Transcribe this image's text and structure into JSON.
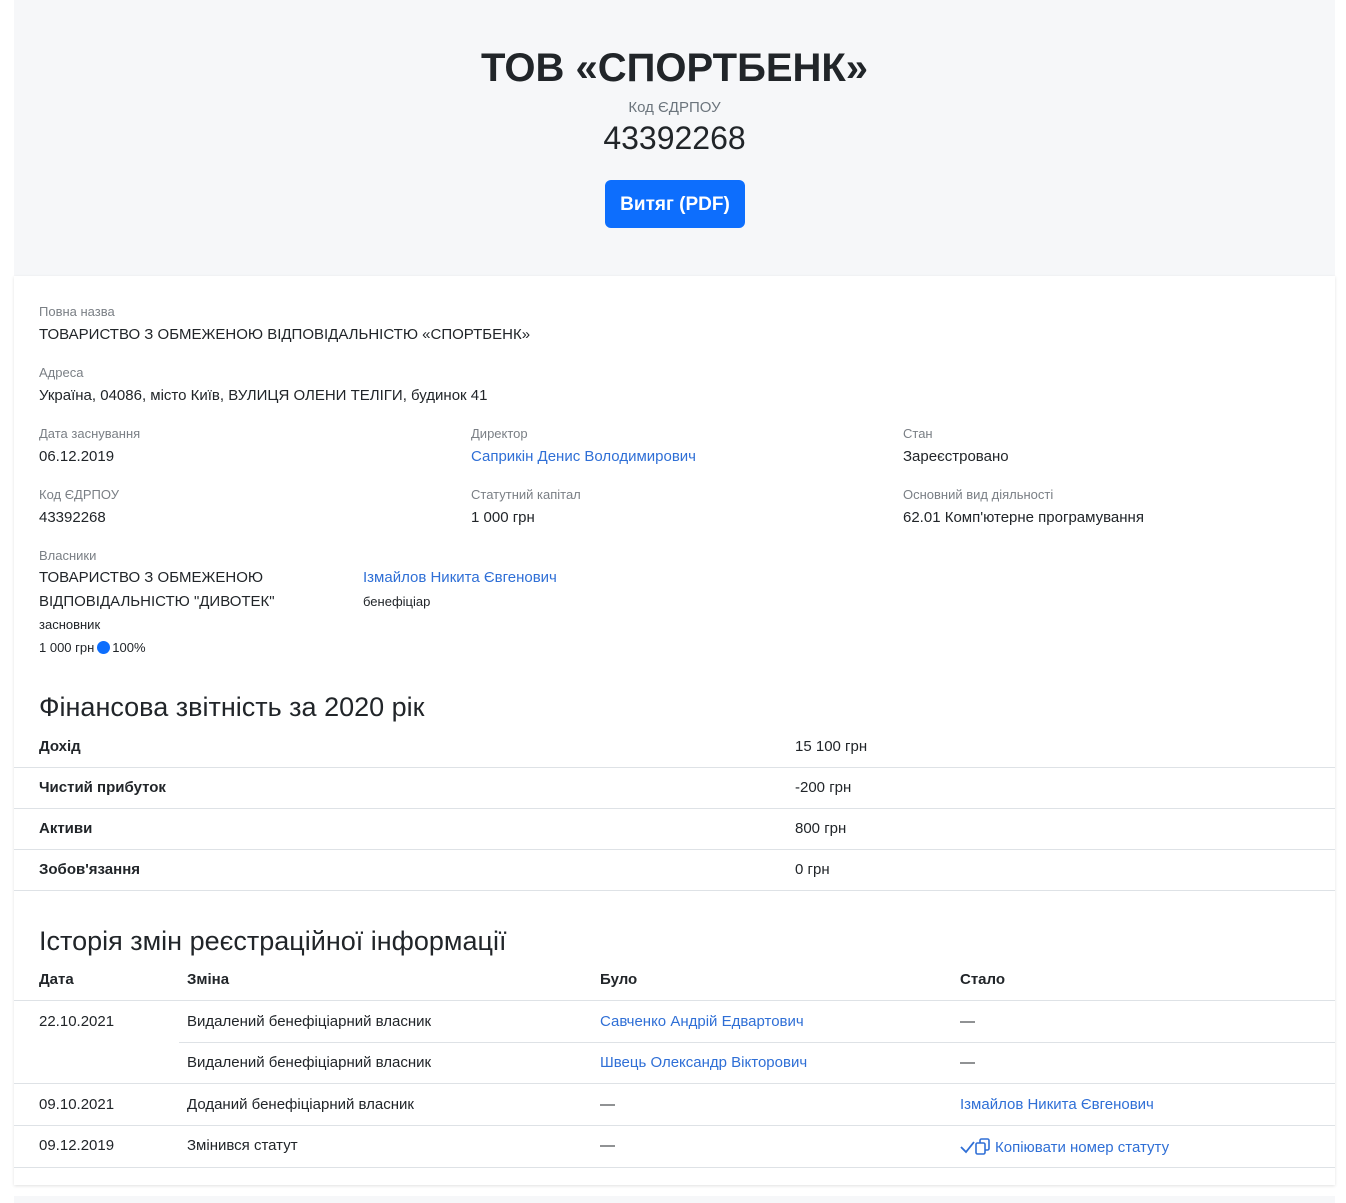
{
  "header": {
    "company_short": "ТОВ «СПОРТБЕНК»",
    "code_label": "Код ЄДРПОУ",
    "code": "43392268",
    "pdf_button": "Витяг (PDF)"
  },
  "details": {
    "full_name_label": "Повна назва",
    "full_name": "ТОВАРИСТВО З ОБМЕЖЕНОЮ ВІДПОВІДАЛЬНІСТЮ «СПОРТБЕНК»",
    "address_label": "Адреса",
    "address": "Україна, 04086, місто Київ, ВУЛИЦЯ ОЛЕНИ ТЕЛІГИ, будинок 41",
    "founded_label": "Дата заснування",
    "founded": "06.12.2019",
    "director_label": "Директор",
    "director": "Саприкін Денис Володимирович",
    "status_label": "Стан",
    "status": "Зареєстровано",
    "edrpou_label": "Код ЄДРПОУ",
    "edrpou": "43392268",
    "capital_label": "Статутний капітал",
    "capital": "1 000 грн",
    "activity_label": "Основний вид діяльності",
    "activity": "62.01 Комп'ютерне програмування",
    "owners_label": "Власники",
    "owners": [
      {
        "name_line1": "ТОВАРИСТВО З ОБМЕЖЕНОЮ",
        "name_line2": "ВІДПОВІДАЛЬНІСТЮ \"ДИВОТЕК\"",
        "role": "засновник",
        "amount": "1 000 грн",
        "share": "100%"
      },
      {
        "name": "Ізмайлов Никита Євгенович",
        "role": "бенефіціар"
      }
    ]
  },
  "finance": {
    "title": "Фінансова звітність за 2020 рік",
    "rows": [
      {
        "label": "Дохід",
        "value": "15 100 грн"
      },
      {
        "label": "Чистий прибуток",
        "value": "-200 грн"
      },
      {
        "label": "Активи",
        "value": "800 грн"
      },
      {
        "label": "Зобов'язання",
        "value": "0 грн"
      }
    ]
  },
  "history": {
    "title": "Історія змін реєстраційної інформації",
    "columns": [
      "Дата",
      "Зміна",
      "Було",
      "Стало"
    ],
    "rows": [
      {
        "date": "22.10.2021",
        "change": "Видалений бенефіціарний власник",
        "was": "Савченко Андрій Едвартович",
        "now": "—"
      },
      {
        "date": "",
        "change": "Видалений бенефіціарний власник",
        "was": "Швець Олександр Вікторович",
        "now": "—"
      },
      {
        "date": "09.10.2021",
        "change": "Доданий бенефіціарний власник",
        "was": "—",
        "now": "Ізмайлов Никита Євгенович"
      },
      {
        "date": "09.12.2019",
        "change": "Змінився статут",
        "was": "—",
        "now": "Копіювати номер статуту"
      }
    ]
  },
  "colors": {
    "accent": "#0d6efd",
    "link": "#2f6fd6",
    "hero_bg": "#f6f7f9",
    "border": "#dee2e6"
  }
}
